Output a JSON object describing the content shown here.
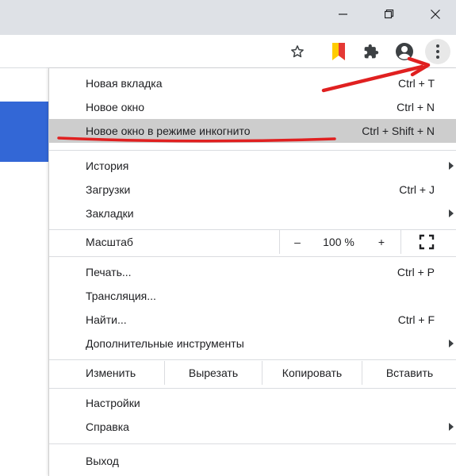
{
  "window": {
    "minimize_icon": "minimize-icon",
    "maximize_icon": "restore-icon",
    "close_icon": "close-icon"
  },
  "toolbar": {
    "icons": [
      "star-icon",
      "bookmark-flag-icon",
      "puzzle-extensions-icon",
      "account-icon",
      "more-vert-icon"
    ]
  },
  "menu": {
    "group1": [
      {
        "label": "Новая вкладка",
        "shortcut": "Ctrl + T"
      },
      {
        "label": "Новое окно",
        "shortcut": "Ctrl + N"
      },
      {
        "label": "Новое окно в режиме инкогнито",
        "shortcut": "Ctrl + Shift + N",
        "highlighted": true
      }
    ],
    "group2": [
      {
        "label": "История",
        "shortcut": "",
        "submenu": true
      },
      {
        "label": "Загрузки",
        "shortcut": "Ctrl + J"
      },
      {
        "label": "Закладки",
        "shortcut": "",
        "submenu": true
      }
    ],
    "zoom": {
      "label": "Масштаб",
      "minus": "–",
      "value": "100 %",
      "plus": "+",
      "fullscreen_icon": "fullscreen-icon"
    },
    "group3": [
      {
        "label": "Печать...",
        "shortcut": "Ctrl + P"
      },
      {
        "label": "Трансляция...",
        "shortcut": ""
      },
      {
        "label": "Найти...",
        "shortcut": "Ctrl + F"
      },
      {
        "label": "Дополнительные инструменты",
        "shortcut": "",
        "submenu": true
      }
    ],
    "edit": {
      "label": "Изменить",
      "cut": "Вырезать",
      "copy": "Копировать",
      "paste": "Вставить"
    },
    "group4": [
      {
        "label": "Настройки",
        "shortcut": ""
      },
      {
        "label": "Справка",
        "shortcut": "",
        "submenu": true
      }
    ],
    "exit": {
      "label": "Выход"
    }
  },
  "colors": {
    "accent_blue": "#3367d6",
    "highlight": "#cdcdcd",
    "annotation_red": "#e02020"
  }
}
